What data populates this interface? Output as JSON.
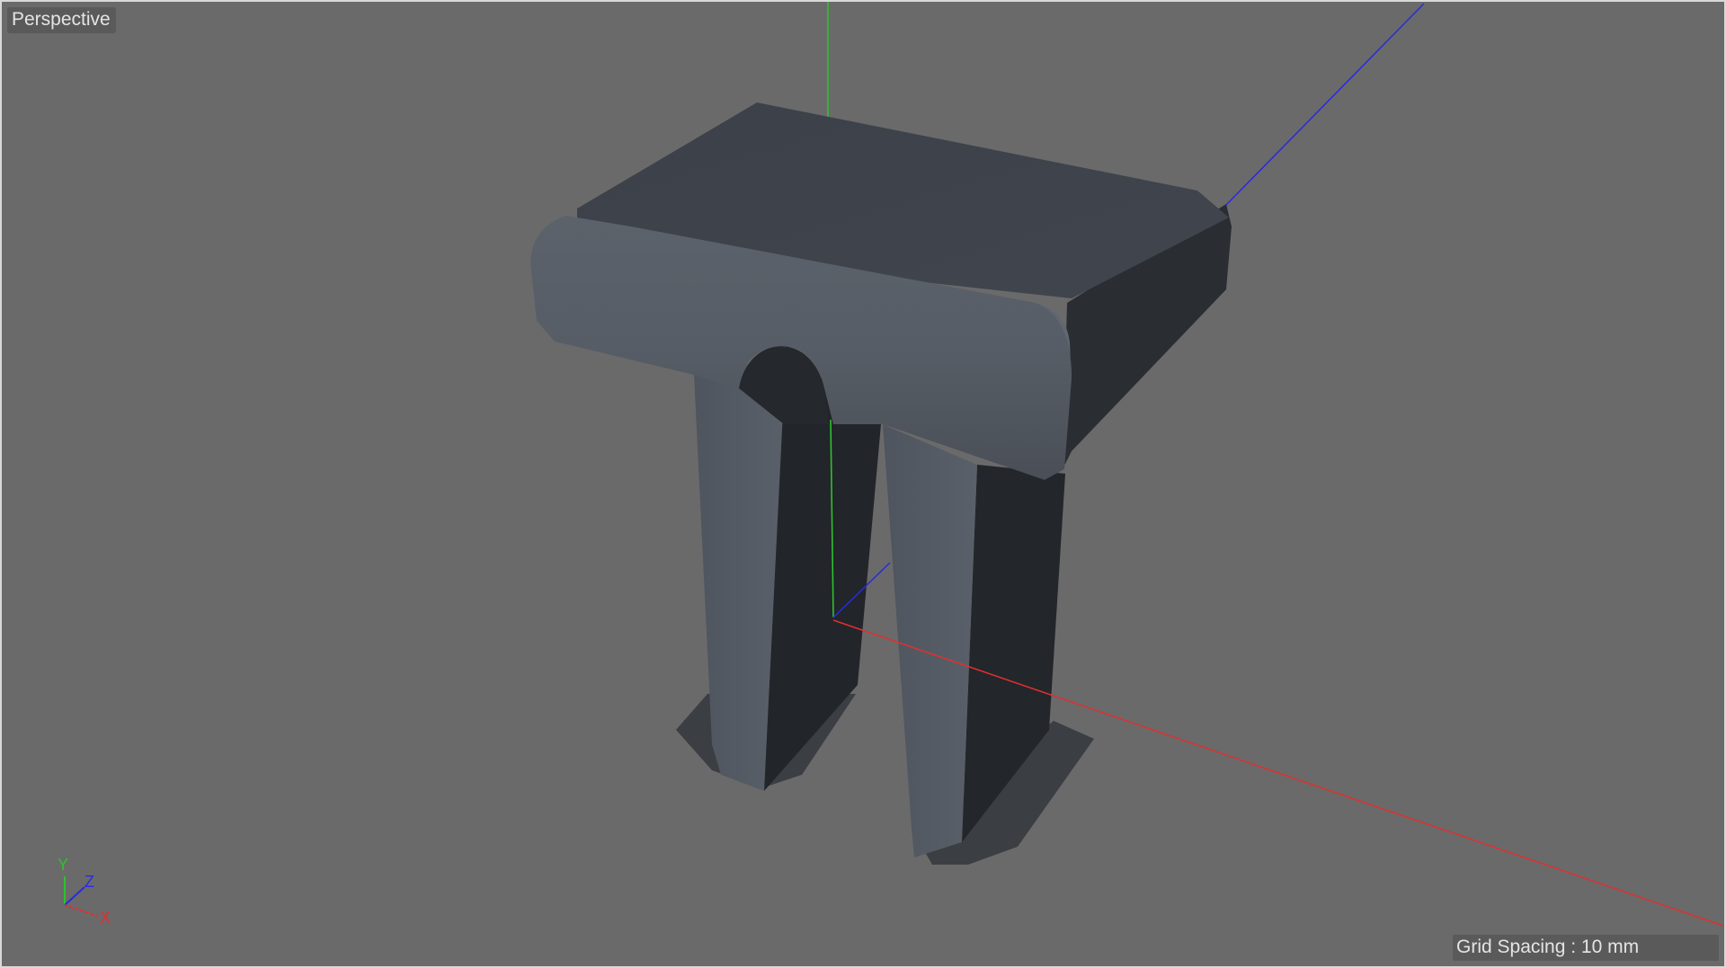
{
  "viewport": {
    "view_name": "Perspective",
    "grid_spacing_text": "Grid Spacing : 10 mm"
  },
  "gizmo": {
    "y_label": "Y",
    "z_label": "Z",
    "x_label": "X"
  },
  "colors": {
    "background": "#6a6a6a",
    "x_axis": "#e03030",
    "y_axis": "#30c030",
    "z_axis": "#2a2ae0",
    "model_top": "#3e434b",
    "model_front": "#545a63",
    "model_shadow": "#23262a"
  },
  "model": {
    "icon": "pi-shaped-solid"
  }
}
